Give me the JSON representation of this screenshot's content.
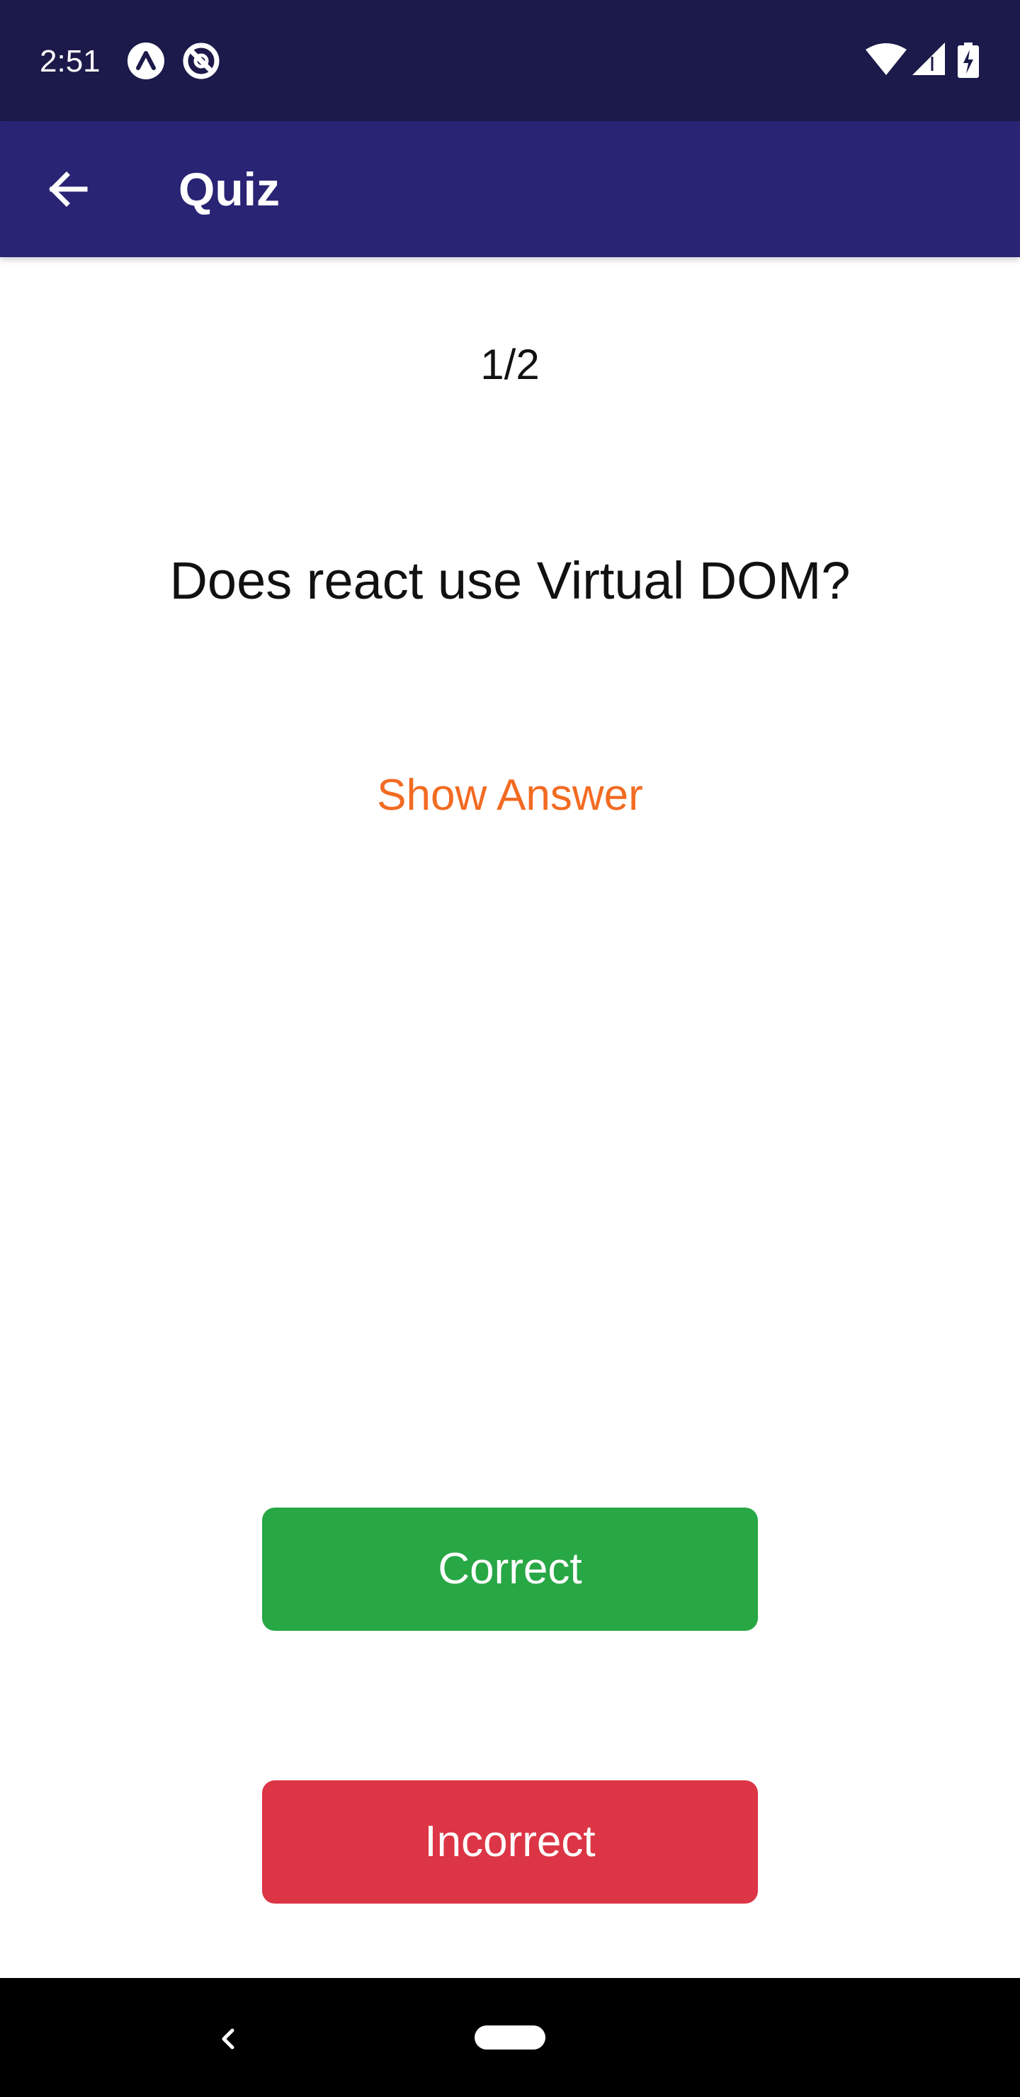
{
  "status_bar": {
    "time": "2:51",
    "icons": [
      "expo-icon",
      "do-not-disturb-icon",
      "wifi-icon",
      "cellular-signal-icon",
      "battery-charging-icon"
    ]
  },
  "app_bar": {
    "title": "Quiz",
    "back_icon": "arrow-back-icon"
  },
  "quiz": {
    "counter": "1/2",
    "question": "Does react use Virtual DOM?",
    "show_answer_label": "Show Answer",
    "correct_label": "Correct",
    "incorrect_label": "Incorrect"
  },
  "colors": {
    "status_bar": "#1c1a4a",
    "app_bar": "#2a2475",
    "show_answer": "#f26b22",
    "correct": "#28a745",
    "incorrect": "#dc3545"
  },
  "nav_bar": {
    "icons": [
      "nav-back-icon",
      "home-pill-icon"
    ]
  }
}
